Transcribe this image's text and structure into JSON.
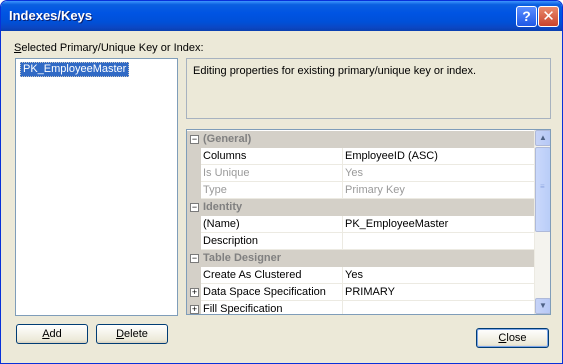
{
  "window": {
    "title": "Indexes/Keys",
    "help_button": "?",
    "close_glyph": "✕"
  },
  "keys_panel": {
    "label_accel": "S",
    "label_rest": "elected Primary/Unique Key or Index:",
    "items": [
      "PK_EmployeeMaster"
    ],
    "selected_index": 0
  },
  "description": "Editing properties for existing primary/unique key or index.",
  "property_grid": {
    "rows": [
      {
        "kind": "category",
        "label": "(General)",
        "expander": "⊟"
      },
      {
        "kind": "property",
        "name": "Columns",
        "value": "EmployeeID (ASC)",
        "disabled": false
      },
      {
        "kind": "property",
        "name": "Is Unique",
        "value": "Yes",
        "disabled": true
      },
      {
        "kind": "property",
        "name": "Type",
        "value": "Primary Key",
        "disabled": true
      },
      {
        "kind": "category",
        "label": "Identity",
        "expander": "⊟"
      },
      {
        "kind": "property",
        "name": "(Name)",
        "value": "PK_EmployeeMaster",
        "disabled": false
      },
      {
        "kind": "property",
        "name": "Description",
        "value": "",
        "disabled": false
      },
      {
        "kind": "category",
        "label": "Table Designer",
        "expander": "⊟"
      },
      {
        "kind": "property",
        "name": "Create As Clustered",
        "value": "Yes",
        "disabled": false
      },
      {
        "kind": "expandable",
        "name": "Data Space Specification",
        "value": "PRIMARY",
        "disabled": false
      },
      {
        "kind": "expandable",
        "name": "Fill Specification",
        "value": "",
        "disabled": false
      }
    ],
    "scroll_up": "▲",
    "scroll_down": "▼",
    "grip": "≡"
  },
  "buttons": {
    "add_accel": "A",
    "add_rest": "dd",
    "delete_accel": "D",
    "delete_rest": "elete",
    "close_accel": "C",
    "close_rest": "lose"
  },
  "colors": {
    "titlebar": "#0054e3",
    "dialog_bg": "#ece9d8",
    "selection": "#316ac5",
    "category_bg": "#d4d0c8",
    "disabled_text": "#9a9a9a"
  }
}
